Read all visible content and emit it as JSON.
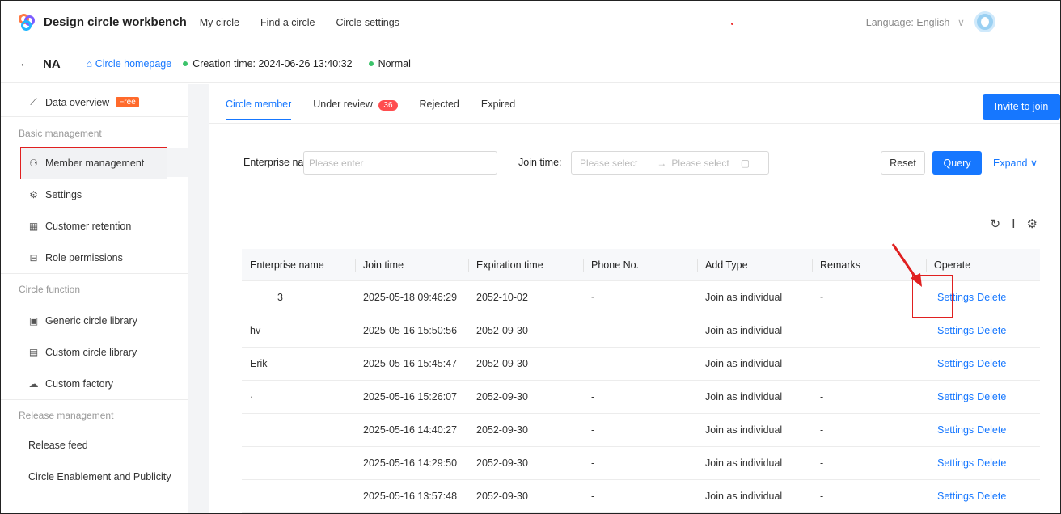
{
  "header": {
    "app_title": "Design circle workbench",
    "nav": [
      "My circle",
      "Find a circle",
      "Circle settings"
    ],
    "language_label": "Language: English",
    "language_caret": "∨"
  },
  "subheader": {
    "back_icon": "←",
    "circle_name": "NA",
    "home_link": "Circle homepage",
    "home_icon": "⌂",
    "creation_time": "Creation time: 2024-06-26 13:40:32",
    "status": "Normal"
  },
  "sidebar": {
    "data_overview": "Data overview",
    "free_badge": "Free",
    "group_basic": "Basic management",
    "member_management": "Member management",
    "settings": "Settings",
    "customer_retention": "Customer retention",
    "role_permissions": "Role permissions",
    "group_circle": "Circle function",
    "generic_library": "Generic circle library",
    "custom_library": "Custom circle library",
    "custom_factory": "Custom factory",
    "group_release": "Release management",
    "release_feed": "Release feed",
    "enablement": "Circle Enablement and Publicity"
  },
  "tabs": {
    "member": "Circle member",
    "review": "Under review",
    "review_count": "36",
    "rejected": "Rejected",
    "expired": "Expired"
  },
  "invite_label": "Invite to join",
  "filters": {
    "enterprise_label": "Enterprise na",
    "enterprise_placeholder": "Please enter",
    "join_label": "Join time:",
    "start_placeholder": "Please select",
    "range_arrow": "→",
    "end_placeholder": "Please select",
    "reset": "Reset",
    "query": "Query",
    "expand": "Expand ∨"
  },
  "table": {
    "columns": [
      "Enterprise name",
      "Join time",
      "Expiration time",
      "Phone No.",
      "Add Type",
      "Remarks",
      "Operate"
    ],
    "rows": [
      {
        "name": "3",
        "join": "2025-05-18 09:46:29",
        "expire": "2052-10-02",
        "phone": "-",
        "type": "Join as individual",
        "remarks": "-"
      },
      {
        "name": "hv",
        "join": "2025-05-16 15:50:56",
        "expire": "2052-09-30",
        "phone": "-",
        "type": "Join as individual",
        "remarks": "-"
      },
      {
        "name": "Erik",
        "join": "2025-05-16 15:45:47",
        "expire": "2052-09-30",
        "phone": "-",
        "type": "Join as individual",
        "remarks": "-"
      },
      {
        "name": "·",
        "join": "2025-05-16 15:26:07",
        "expire": "2052-09-30",
        "phone": "-",
        "type": "Join as individual",
        "remarks": "-"
      },
      {
        "name": "",
        "join": "2025-05-16 14:40:27",
        "expire": "2052-09-30",
        "phone": "-",
        "type": "Join as individual",
        "remarks": "-"
      },
      {
        "name": "",
        "join": "2025-05-16 14:29:50",
        "expire": "2052-09-30",
        "phone": "-",
        "type": "Join as individual",
        "remarks": "-"
      },
      {
        "name": "",
        "join": "2025-05-16 13:57:48",
        "expire": "2052-09-30",
        "phone": "-",
        "type": "Join as individual",
        "remarks": "-"
      }
    ],
    "settings_link": "Settings",
    "delete_link": "Delete"
  },
  "colors": {
    "accent": "#1677ff",
    "annotation": "#e02020",
    "status_ok": "#3cc36b"
  }
}
